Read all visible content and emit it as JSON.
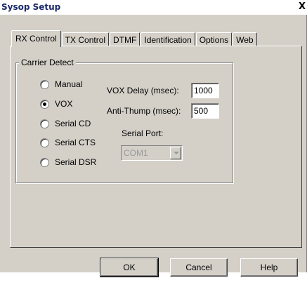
{
  "window": {
    "title": "Sysop Setup",
    "close_glyph": "X"
  },
  "tabs": [
    {
      "label": "RX Control",
      "active": true
    },
    {
      "label": "TX Control",
      "active": false
    },
    {
      "label": "DTMF",
      "active": false
    },
    {
      "label": "Identification",
      "active": false
    },
    {
      "label": "Options",
      "active": false
    },
    {
      "label": "Web",
      "active": false
    }
  ],
  "carrier_detect": {
    "label": "Carrier Detect",
    "options": [
      {
        "label": "Manual",
        "checked": false
      },
      {
        "label": "VOX",
        "checked": true
      },
      {
        "label": "Serial CD",
        "checked": false
      },
      {
        "label": "Serial CTS",
        "checked": false
      },
      {
        "label": "Serial DSR",
        "checked": false
      }
    ],
    "vox_delay_label": "VOX Delay (msec):",
    "vox_delay_value": "1000",
    "anti_thump_label": "Anti-Thump (msec):",
    "anti_thump_value": "500",
    "serial_port_label": "Serial Port:",
    "serial_port_value": "COM1"
  },
  "buttons": {
    "ok": "OK",
    "cancel": "Cancel",
    "help": "Help"
  }
}
